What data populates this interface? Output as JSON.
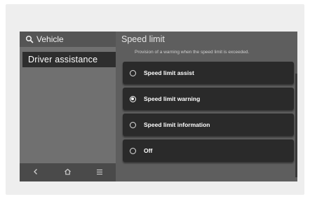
{
  "sidebar": {
    "header_icon": "search-icon",
    "header_label": "Vehicle",
    "active_item": "Driver assistance",
    "bottom_nav": [
      {
        "icon": "back-icon",
        "glyph": "‹"
      },
      {
        "icon": "home-icon"
      },
      {
        "icon": "menu-icon",
        "glyph": "≡"
      }
    ]
  },
  "main": {
    "title": "Speed limit",
    "subtitle": "Provision of a warning when the speed limit is exceeded.",
    "options": [
      {
        "label": "Speed limit assist",
        "selected": false
      },
      {
        "label": "Speed limit warning",
        "selected": true
      },
      {
        "label": "Speed limit information",
        "selected": false
      },
      {
        "label": "Off",
        "selected": false
      }
    ]
  },
  "colors": {
    "screen_bg": "#5b5b5b",
    "sidebar_bg": "#707070",
    "active_item_bg": "#2e2e2e",
    "option_bg": "#2a2a2a",
    "text": "#ffffff"
  }
}
